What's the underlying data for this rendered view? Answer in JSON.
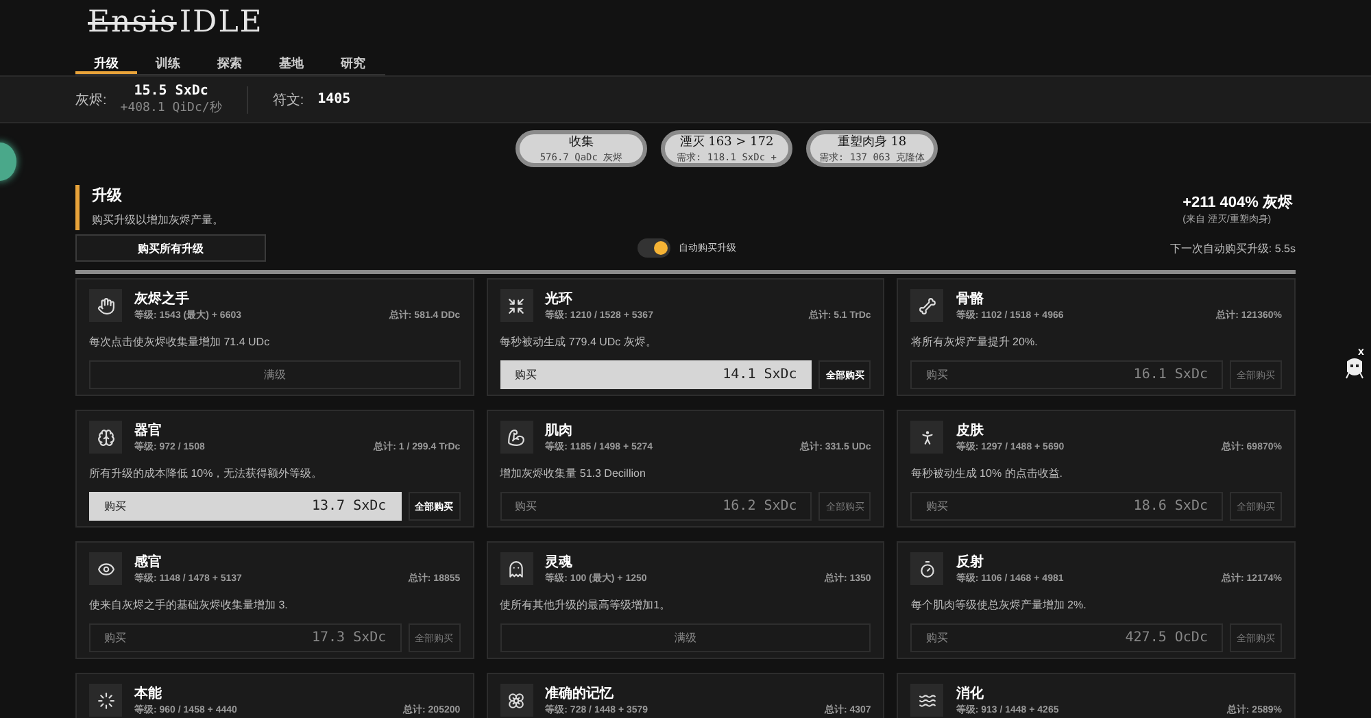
{
  "logo": {
    "struck": "Ensis",
    "plain": "IDLE"
  },
  "tabs": [
    {
      "label": "升级",
      "selected": true
    },
    {
      "label": "训练",
      "selected": false
    },
    {
      "label": "探索",
      "selected": false
    },
    {
      "label": "基地",
      "selected": false
    },
    {
      "label": "研究",
      "selected": false
    }
  ],
  "resources": {
    "ash_label": "灰烬:",
    "ash_value": "15.5 SxDc",
    "ash_rate": "+408.1 QiDc/秒",
    "runes_label": "符文:",
    "runes_value": "1405"
  },
  "actions": [
    {
      "title": "收集",
      "sub": "576.7 QaDc 灰烬"
    },
    {
      "title": "湮灭 163 > 172",
      "sub": "需求: 118.1 SxDc +"
    },
    {
      "title": "重塑肉身 18",
      "sub": "需求: 137 063 克隆体"
    }
  ],
  "section": {
    "title": "升级",
    "subtitle": "购买升级以增加灰烬产量。",
    "buy_all": "购买所有升级",
    "bonus": "+211 404% 灰烬",
    "bonus_source": "(来自 湮灭/重塑肉身)",
    "next_autobuy": "下一次自动购买升级: 5.5s"
  },
  "auto_buy": {
    "label": "自动购买升级",
    "on": true
  },
  "cards": [
    {
      "name": "灰烬之手",
      "level": "等级: 1543 (最大) + 6603",
      "total": "总计: 581.4 DDc",
      "desc": "每次点击使灰烬收集量增加 71.4 UDc",
      "kind": "max",
      "max_label": "满级"
    },
    {
      "name": "光环",
      "level": "等级: 1210 / 1528 + 5367",
      "total": "总计: 5.1 TrDc",
      "desc": "每秒被动生成 779.4 UDc 灰烬。",
      "kind": "buy",
      "buy_label": "购买",
      "price": "14.1 SxDc",
      "all_label": "全部购买",
      "affordable": true
    },
    {
      "name": "骨骼",
      "level": "等级: 1102 / 1518 + 4966",
      "total": "总计: 121360%",
      "desc": "将所有灰烬产量提升 20%.",
      "kind": "buy",
      "buy_label": "购买",
      "price": "16.1 SxDc",
      "all_label": "全部购买",
      "affordable": false
    },
    {
      "name": "器官",
      "level": "等级: 972 / 1508",
      "total": "总计: 1 / 299.4 TrDc",
      "desc": "所有升级的成本降低 10%，无法获得额外等级。",
      "kind": "buy",
      "buy_label": "购买",
      "price": "13.7 SxDc",
      "all_label": "全部购买",
      "affordable": true
    },
    {
      "name": "肌肉",
      "level": "等级: 1185 / 1498 + 5274",
      "total": "总计: 331.5 UDc",
      "desc": "增加灰烬收集量 51.3 Decillion",
      "kind": "buy",
      "buy_label": "购买",
      "price": "16.2 SxDc",
      "all_label": "全部购买",
      "affordable": false
    },
    {
      "name": "皮肤",
      "level": "等级: 1297 / 1488 + 5690",
      "total": "总计: 69870%",
      "desc": "每秒被动生成 10% 的点击收益.",
      "kind": "buy",
      "buy_label": "购买",
      "price": "18.6 SxDc",
      "all_label": "全部购买",
      "affordable": false
    },
    {
      "name": "感官",
      "level": "等级: 1148 / 1478 + 5137",
      "total": "总计: 18855",
      "desc": "使来自灰烬之手的基础灰烬收集量增加 3.",
      "kind": "buy",
      "buy_label": "购买",
      "price": "17.3 SxDc",
      "all_label": "全部购买",
      "affordable": false
    },
    {
      "name": "灵魂",
      "level": "等级: 100 (最大) + 1250",
      "total": "总计: 1350",
      "desc": "使所有其他升级的最高等级增加1。",
      "kind": "max",
      "max_label": "满级"
    },
    {
      "name": "反射",
      "level": "等级: 1106 / 1468 + 4981",
      "total": "总计: 12174%",
      "desc": "每个肌肉等级使总灰烬产量增加 2%.",
      "kind": "buy",
      "buy_label": "购买",
      "price": "427.5 OcDc",
      "all_label": "全部购买",
      "affordable": false
    },
    {
      "name": "本能",
      "level": "等级: 960 / 1458 + 4440",
      "total": "总计: 205200"
    },
    {
      "name": "准确的记忆",
      "level": "等级: 728 / 1448 + 3579",
      "total": "总计: 4307"
    },
    {
      "name": "消化",
      "level": "等级: 913 / 1448 + 4265",
      "total": "总计: 2589%"
    }
  ],
  "helper": {
    "close": "x"
  }
}
